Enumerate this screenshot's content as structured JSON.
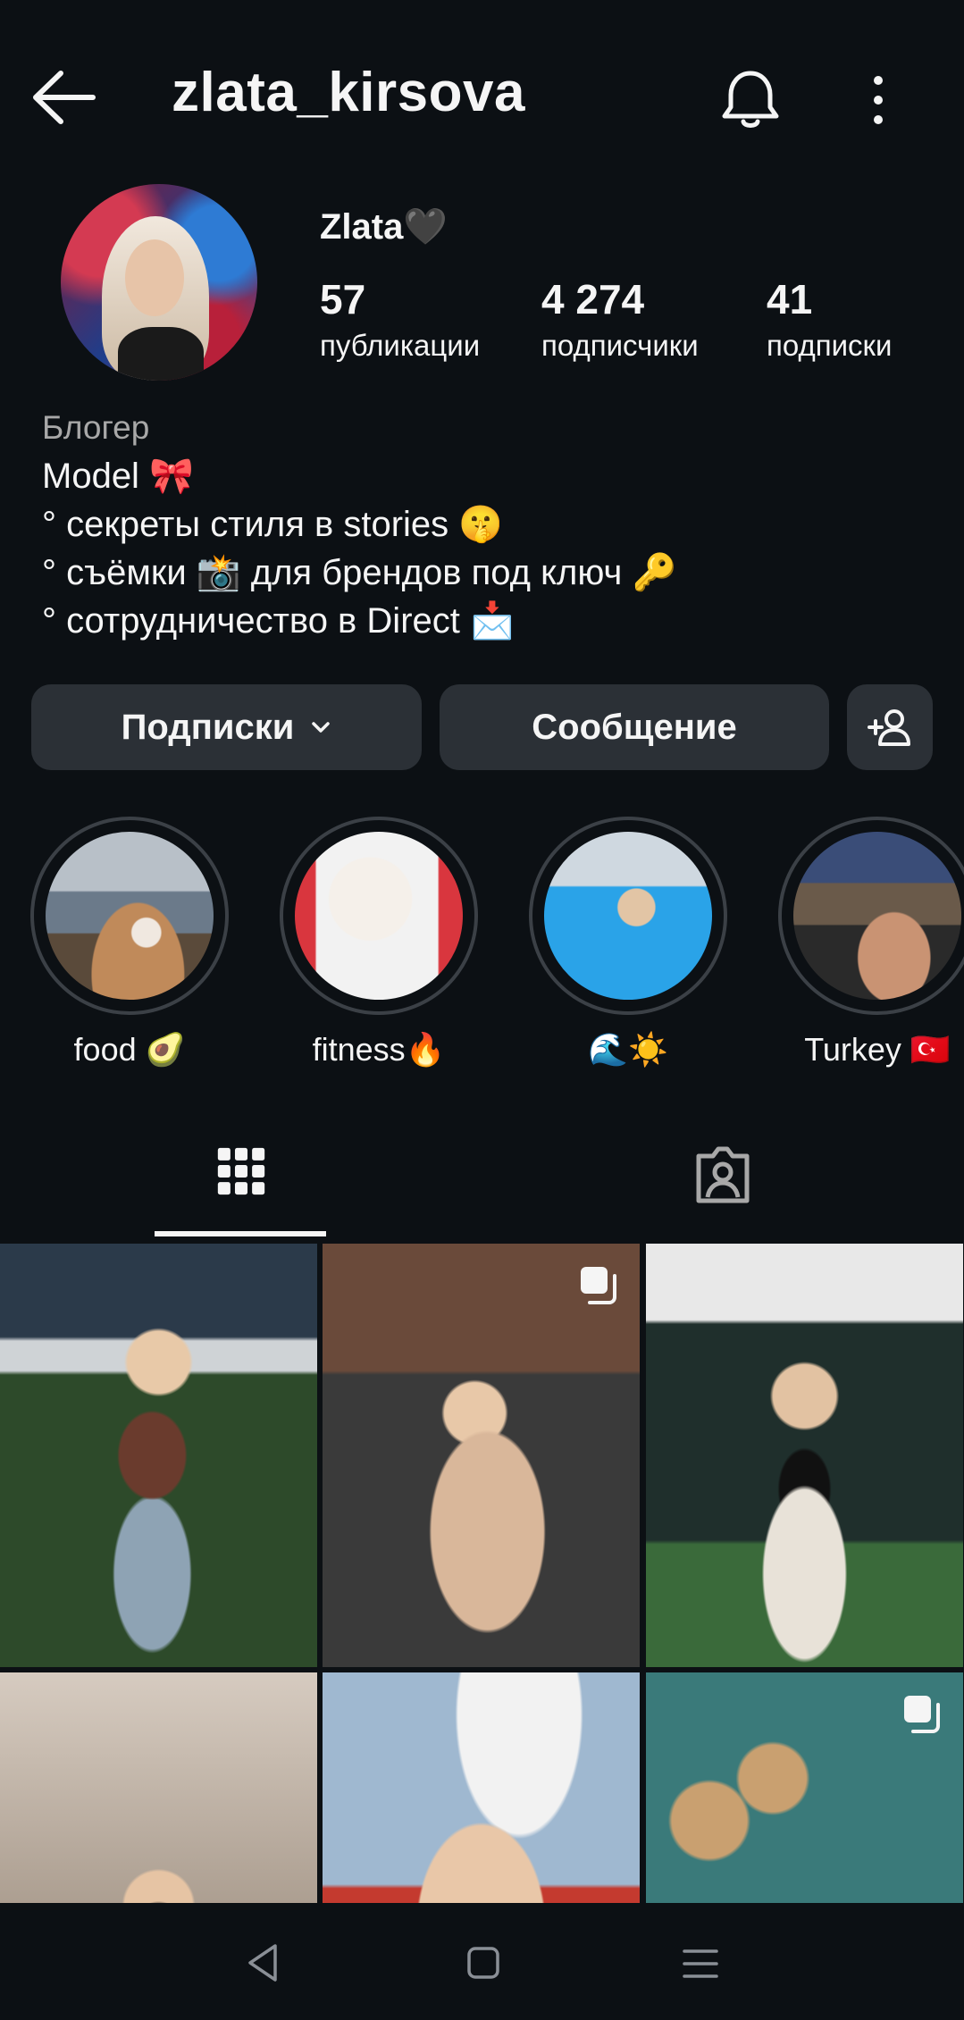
{
  "header": {
    "username": "zlata_kirsova"
  },
  "profile": {
    "display_name": "Zlata🖤",
    "stats": [
      {
        "value": "57",
        "label": "публикации"
      },
      {
        "value": "4 274",
        "label": "подписчики"
      },
      {
        "value": "41",
        "label": "подписки"
      }
    ],
    "bio": {
      "category": "Блогер",
      "lines": [
        "Model 🎀",
        "° секреты стиля в stories 🤫",
        "° съёмки 📸 для брендов под ключ 🔑",
        "° сотрудничество в Direct 📩"
      ]
    }
  },
  "actions": {
    "following_label": "Подписки",
    "message_label": "Сообщение"
  },
  "highlights": [
    {
      "caption": "food 🥑"
    },
    {
      "caption": "fitness🔥"
    },
    {
      "caption": "🌊☀️"
    },
    {
      "caption": "Turkey 🇹🇷"
    }
  ],
  "tabs": [
    {
      "icon": "grid-icon",
      "active": true
    },
    {
      "icon": "tagged-icon",
      "active": false
    }
  ],
  "posts": [
    {
      "multi": false
    },
    {
      "multi": true
    },
    {
      "multi": false
    },
    {
      "multi": false
    },
    {
      "multi": false
    },
    {
      "multi": true
    }
  ],
  "colors": {
    "background": "#0c1014",
    "button": "#2b3036",
    "text": "#f5f5f5",
    "muted": "#a8a8a8"
  }
}
